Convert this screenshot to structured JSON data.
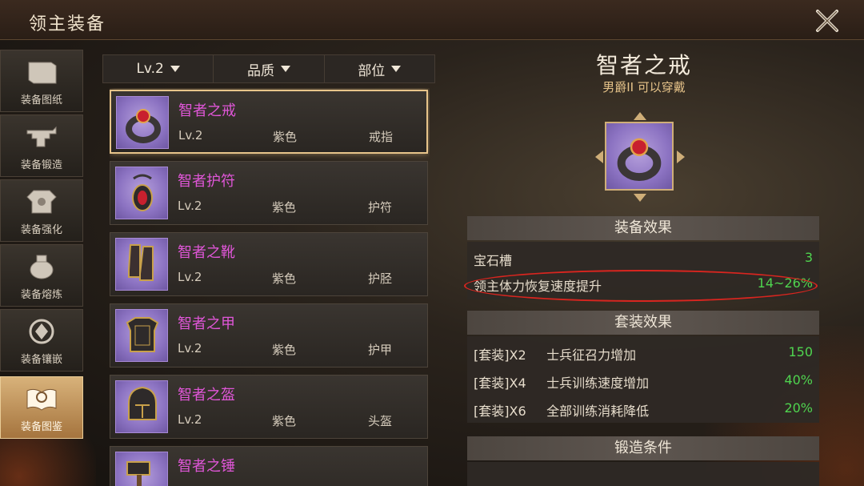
{
  "header": {
    "title": "领主装备"
  },
  "sidebar": {
    "items": [
      {
        "label": "装备图纸",
        "icon": "scroll-icon"
      },
      {
        "label": "装备锻造",
        "icon": "anvil-icon"
      },
      {
        "label": "装备强化",
        "icon": "armor-upgrade-icon"
      },
      {
        "label": "装备熔炼",
        "icon": "cauldron-icon"
      },
      {
        "label": "装备镶嵌",
        "icon": "gem-socket-icon"
      },
      {
        "label": "装备图鉴",
        "icon": "codex-book-icon",
        "active": true
      }
    ]
  },
  "filters": [
    {
      "label": "Lv.2"
    },
    {
      "label": "品质"
    },
    {
      "label": "部位"
    }
  ],
  "equipment_list": [
    {
      "name": "智者之戒",
      "level": "Lv.2",
      "quality": "紫色",
      "slot": "戒指",
      "selected": true,
      "icon": "ring-icon"
    },
    {
      "name": "智者护符",
      "level": "Lv.2",
      "quality": "紫色",
      "slot": "护符",
      "icon": "amulet-icon"
    },
    {
      "name": "智者之靴",
      "level": "Lv.2",
      "quality": "紫色",
      "slot": "护胫",
      "icon": "boots-icon"
    },
    {
      "name": "智者之甲",
      "level": "Lv.2",
      "quality": "紫色",
      "slot": "护甲",
      "icon": "armor-icon"
    },
    {
      "name": "智者之盔",
      "level": "Lv.2",
      "quality": "紫色",
      "slot": "头盔",
      "icon": "helmet-icon"
    },
    {
      "name": "智者之锤",
      "level": "",
      "quality": "",
      "slot": "",
      "icon": "hammer-icon"
    }
  ],
  "detail": {
    "name": "智者之戒",
    "requirement": "男爵II 可以穿戴",
    "equip_effect": {
      "title": "装备效果",
      "rows": [
        {
          "label": "宝石槽",
          "value": "3"
        },
        {
          "label": "领主体力恢复速度提升",
          "value": "14~26%"
        }
      ]
    },
    "set_effect": {
      "title": "套装效果",
      "rows": [
        {
          "tag": "[套装]X2",
          "label": "士兵征召力增加",
          "value": "150"
        },
        {
          "tag": "[套装]X4",
          "label": "士兵训练速度增加",
          "value": "40%"
        },
        {
          "tag": "[套装]X6",
          "label": "全部训练消耗降低",
          "value": "20%"
        }
      ]
    },
    "forge": {
      "title": "锻造条件"
    }
  },
  "colors": {
    "purple_name": "#e056d8",
    "green_value": "#4fd44f",
    "gold_border": "#e7c48a",
    "highlight_red": "#d9251f"
  }
}
